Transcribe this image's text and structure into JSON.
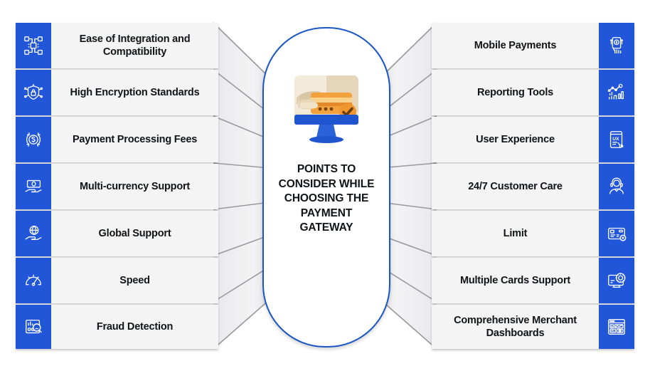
{
  "diagram": {
    "title_lines": [
      "POINTS TO",
      "CONSIDER WHILE",
      "CHOOSING THE",
      "PAYMENT",
      "GATEWAY"
    ],
    "center_illustration_name": "monitor-credit-card-approved-illustration",
    "colors": {
      "accent_blue": "#2156d8",
      "oval_border_blue": "#1a56c4",
      "row_background": "#f4f4f5",
      "connector_gray": "#e6e6e8",
      "connector_line": "#9a9a9e",
      "text_dark": "#111318",
      "illustration_orange": "#f0962f",
      "illustration_cream": "#f3ead9",
      "illustration_tan": "#d9c6a7"
    }
  },
  "left_column": {
    "items": [
      {
        "label": "Ease of Integration and Compatibility",
        "icon": "network-nodes-icon"
      },
      {
        "label": "High Encryption Standards",
        "icon": "shield-lock-icon"
      },
      {
        "label": "Payment Processing Fees",
        "icon": "dollar-refresh-icon"
      },
      {
        "label": "Multi-currency Support",
        "icon": "banknote-hand-icon"
      },
      {
        "label": "Global Support",
        "icon": "globe-hand-icon"
      },
      {
        "label": "Speed",
        "icon": "speedometer-icon"
      },
      {
        "label": "Fraud Detection",
        "icon": "fraud-magnifier-icon"
      }
    ]
  },
  "right_column": {
    "items": [
      {
        "label": "Mobile Payments",
        "icon": "mobile-payment-icon"
      },
      {
        "label": "Reporting Tools",
        "icon": "analytics-report-icon"
      },
      {
        "label": "User Experience",
        "icon": "ux-mobile-icon"
      },
      {
        "label": "24/7 Customer Care",
        "icon": "headset-agent-icon"
      },
      {
        "label": "Limit",
        "icon": "card-limit-icon"
      },
      {
        "label": "Multiple Cards Support",
        "icon": "monitor-gear-card-icon"
      },
      {
        "label": "Comprehensive Merchant Dashboards",
        "icon": "dashboard-window-icon"
      }
    ]
  }
}
